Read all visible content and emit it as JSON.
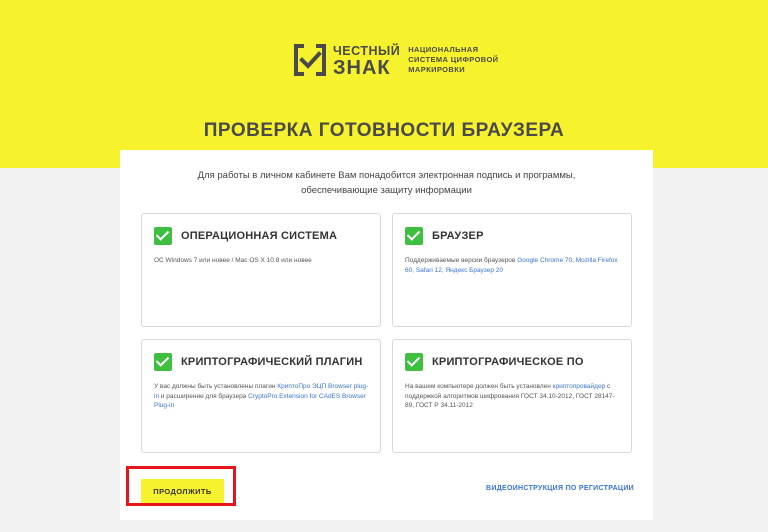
{
  "brand": {
    "name_line1": "ЧЕСТНЫЙ",
    "name_line2": "ЗНАК",
    "tagline_lines": [
      "НАЦИОНАЛЬНАЯ",
      "СИСТЕМА ЦИФРОВОЙ",
      "МАРКИРОВКИ"
    ]
  },
  "page_title": "ПРОВЕРКА ГОТОВНОСТИ БРАУЗЕРА",
  "intro_lines": [
    "Для работы в личном кабинете Вам понадобится электронная подпись и программы,",
    "обеспечивающие защиту информации"
  ],
  "tiles": [
    {
      "title": "ОПЕРАЦИОННАЯ СИСТЕМА",
      "status": "checked",
      "desc": [
        {
          "text": "ОС Windows 7 или новее / Mac OS X 10.8 или новее",
          "link": false
        }
      ]
    },
    {
      "title": "БРАУЗЕР",
      "status": "checked",
      "desc": [
        {
          "text": "Поддерживаемые версии браузеров ",
          "link": false
        },
        {
          "text": "Google Chrome 70, Mozilla Firefox 60, Safari 12, Яндекс Браузер 20",
          "link": true
        }
      ]
    },
    {
      "title": "КРИПТОГРАФИЧЕСКИЙ ПЛАГИН",
      "status": "checked",
      "desc": [
        {
          "text": "У вас должны быть установлены плагин ",
          "link": false
        },
        {
          "text": "КриптоПро ЭЦП Browser plug-in",
          "link": true
        },
        {
          "text": " и расширение для браузера ",
          "link": false
        },
        {
          "text": "CryptoPro Extension for CAdES Browser Plug-in",
          "link": true
        }
      ]
    },
    {
      "title": "КРИПТОГРАФИЧЕСКОЕ ПО",
      "status": "checked",
      "desc": [
        {
          "text": "На вашем компьютере должен быть установлен ",
          "link": false
        },
        {
          "text": "криптопровайдер",
          "link": true
        },
        {
          "text": " с поддержкой алгоритмов шифрования ГОСТ 34.10-2012, ГОСТ 28147-89, ГОСТ Р 34.11-2012",
          "link": false
        }
      ]
    }
  ],
  "continue_label": "ПРОДОЛЖИТЬ",
  "video_link_label": "ВИДЕОИНСТРУКЦИЯ ПО РЕГИСТРАЦИИ",
  "colors": {
    "brand_yellow": "#f7f22e",
    "check_green": "#3fbf3f",
    "link_blue": "#3a74d6",
    "highlight_red": "#e8141b"
  }
}
